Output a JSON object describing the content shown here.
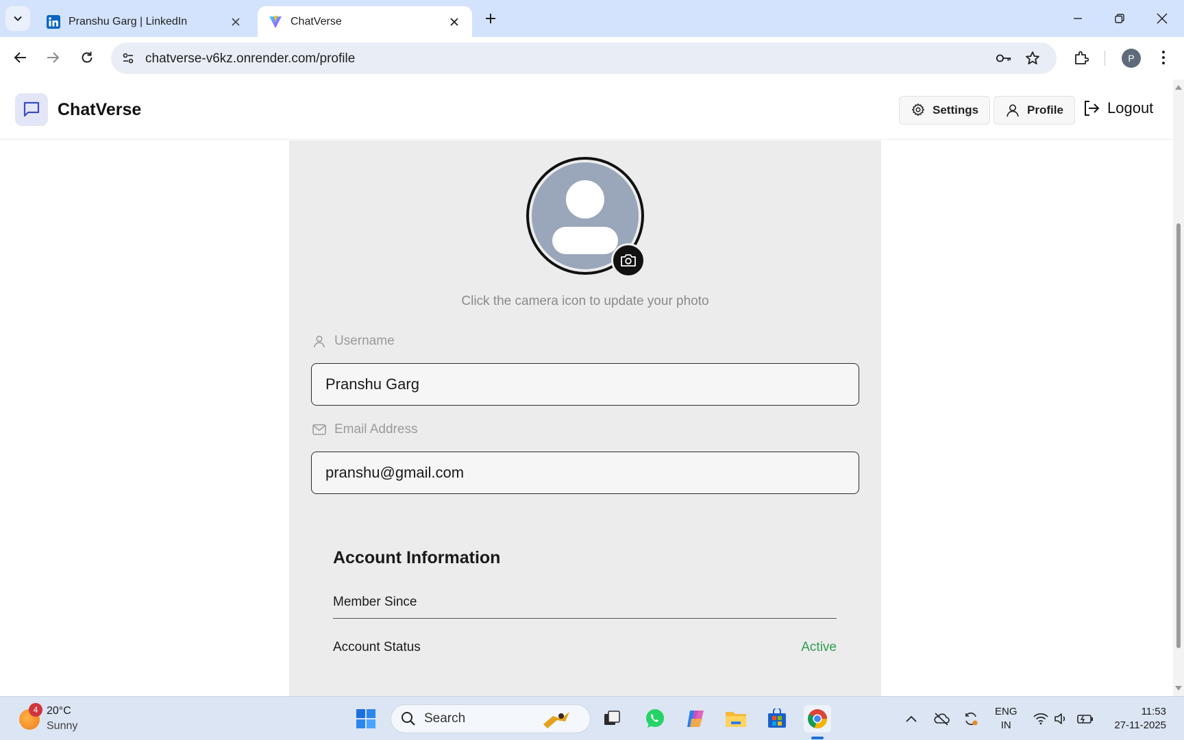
{
  "browser": {
    "tabs": [
      {
        "title": "Pranshu Garg | LinkedIn",
        "favicon": "linkedin-icon",
        "active": false
      },
      {
        "title": "ChatVerse",
        "favicon": "vite-icon",
        "active": true
      }
    ],
    "url": "chatverse-v6kz.onrender.com/profile",
    "profile_initial": "P"
  },
  "app": {
    "brand": "ChatVerse",
    "nav": {
      "settings": "Settings",
      "profile": "Profile",
      "logout": "Logout"
    }
  },
  "profile": {
    "photo_hint": "Click the camera icon to update your photo",
    "username_label": "Username",
    "username_value": "Pranshu Garg",
    "email_label": "Email Address",
    "email_value": "pranshu@gmail.com"
  },
  "account": {
    "title": "Account Information",
    "member_since_label": "Member Since",
    "member_since_value": "",
    "status_label": "Account Status",
    "status_value": "Active"
  },
  "taskbar": {
    "weather": {
      "badge": "4",
      "temp": "20°C",
      "desc": "Sunny"
    },
    "search_placeholder": "Search",
    "lang_top": "ENG",
    "lang_bottom": "IN",
    "time": "11:53",
    "date": "27-11-2025"
  },
  "colors": {
    "accent_brand": "#3b4bc4",
    "status_active": "#2e9e52",
    "card_bg": "#ececec",
    "tabstrip_bg": "#d3e3fd"
  }
}
